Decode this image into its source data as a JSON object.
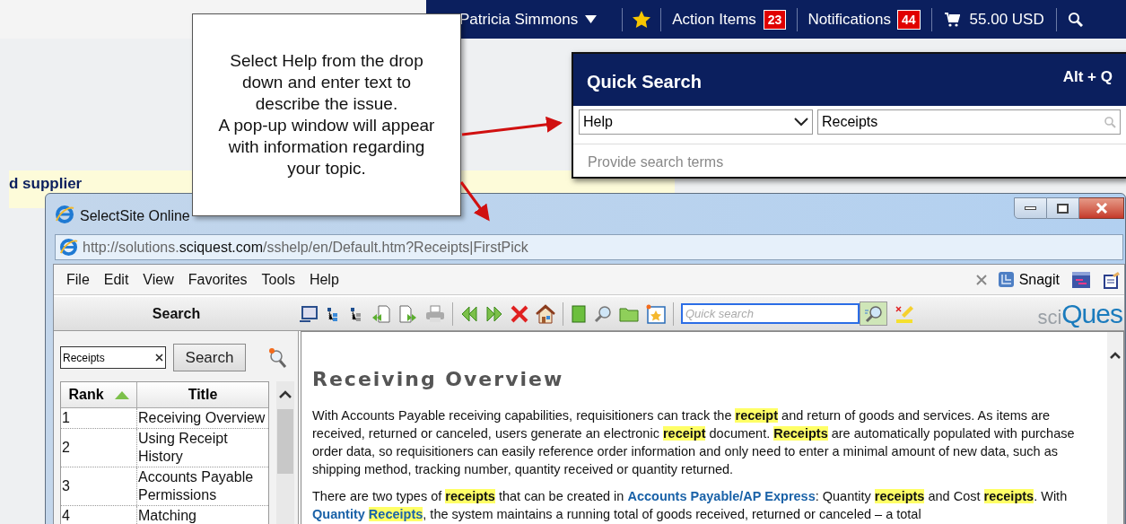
{
  "top_nav": {
    "user": "Patricia Simmons",
    "action_items": {
      "label": "Action Items",
      "count": "23"
    },
    "notifications": {
      "label": "Notifications",
      "count": "44"
    },
    "cart_total": "55.00 USD"
  },
  "page": {
    "banner_text": "d supplier"
  },
  "callout": {
    "lines": [
      "Select Help from the drop down and enter text to describe the issue.",
      "A pop-up window will appear with information regarding your topic."
    ]
  },
  "quick_search": {
    "title": "Quick Search",
    "shortcut": "Alt + Q",
    "category": "Help",
    "query": "Receipts",
    "hint": "Provide search terms"
  },
  "browser": {
    "title": "SelectSite Online",
    "address": "http://solutions.**sciquest.com**/sshelp/en/Default.htm?Receipts|FirstPick",
    "menu": [
      "File",
      "Edit",
      "View",
      "Favorites",
      "Tools",
      "Help"
    ],
    "snagit": "Snagit",
    "toolbar": {
      "pane_title": "Search",
      "quick_search_placeholder": "Quick search",
      "logo_prefix": "sci",
      "logo_main": "Ques"
    },
    "search_pane": {
      "query": "Receipts",
      "button": "Search",
      "columns": [
        "Rank",
        "Title"
      ],
      "rows": [
        {
          "rank": "1",
          "title": "Receiving Overview"
        },
        {
          "rank": "2",
          "title": "Using Receipt History"
        },
        {
          "rank": "3",
          "title": "Accounts Payable Permissions"
        },
        {
          "rank": "4",
          "title": "Matching"
        }
      ]
    },
    "article": {
      "title": "Receiving Overview",
      "paragraphs": [
        [
          {
            "kind": "text",
            "text": "With Accounts Payable receiving capabilities, requisitioners can track the **receipt** and return of goods and services. As items are received, returned or canceled, users generate an electronic **receipt** document. **Receipts** are automatically populated with purchase order data, so requisitioners can easily reference order information and only need to enter a minimal amount of new data, such as shipping method, tracking number, quantity received or quantity returned."
          }
        ],
        [
          {
            "kind": "text",
            "text": "There are two types of **receipts** that can be created in "
          },
          {
            "kind": "link",
            "text": "Accounts Payable/AP Express"
          },
          {
            "kind": "text",
            "text": ": Quantity **receipts** and Cost **receipts**. With "
          },
          {
            "kind": "link",
            "text": "Quantity **Receipts**"
          },
          {
            "kind": "text",
            "text": ", the system maintains a running total of goods received, returned or canceled – a total"
          }
        ]
      ]
    }
  }
}
